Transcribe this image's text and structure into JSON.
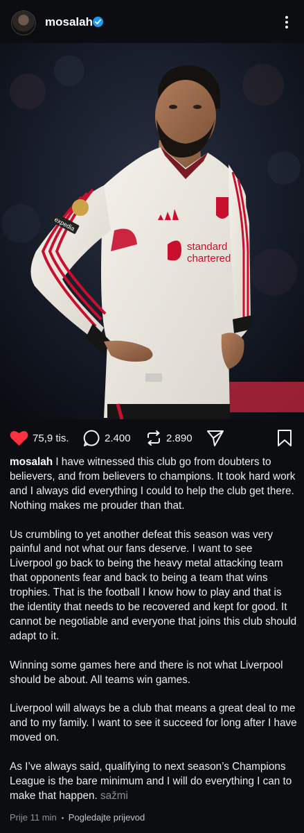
{
  "post": {
    "username": "mosalah",
    "verified": true,
    "likes": "75,9 tis.",
    "comments": "2.400",
    "reposts": "2.890",
    "caption_user": "mosalah",
    "paragraphs": [
      "I have witnessed this club go from doubters to believers, and from believers to champions. It took hard work and I always did everything I could to help the club get there. Nothing makes me prouder than that.",
      "Us crumbling to yet another defeat this season was very painful and not what our fans deserve. I want to see Liverpool go back to being the heavy metal attacking team that opponents fear and back to being a team that wins trophies. That is the football I know how to play and that is the identity that needs to be recovered and kept for good. It cannot be negotiable and everyone that joins this club should adapt to it.",
      "Winning some games here and there is not what Liverpool should be about. All teams win games.",
      "Liverpool will always be a club that means a great deal to me and to my family. I want to see it succeed for long after I have moved on.",
      "As I’ve always said, qualifying to next season’s Champions League is the bare minimum and I will do everything I can to make that happen."
    ],
    "less_label": "sažmi",
    "time_ago": "Prije 11 min",
    "translate_label": "Pogledajte prijevod"
  },
  "shirt": {
    "sponsor_line1": "standard",
    "sponsor_line2": "chartered",
    "sleeve_sponsor": "expedia"
  },
  "colors": {
    "background": "#0b0d10",
    "like_red": "#ff3040",
    "verified_blue": "#1d9bf0",
    "kit_red": "#c8102e"
  }
}
